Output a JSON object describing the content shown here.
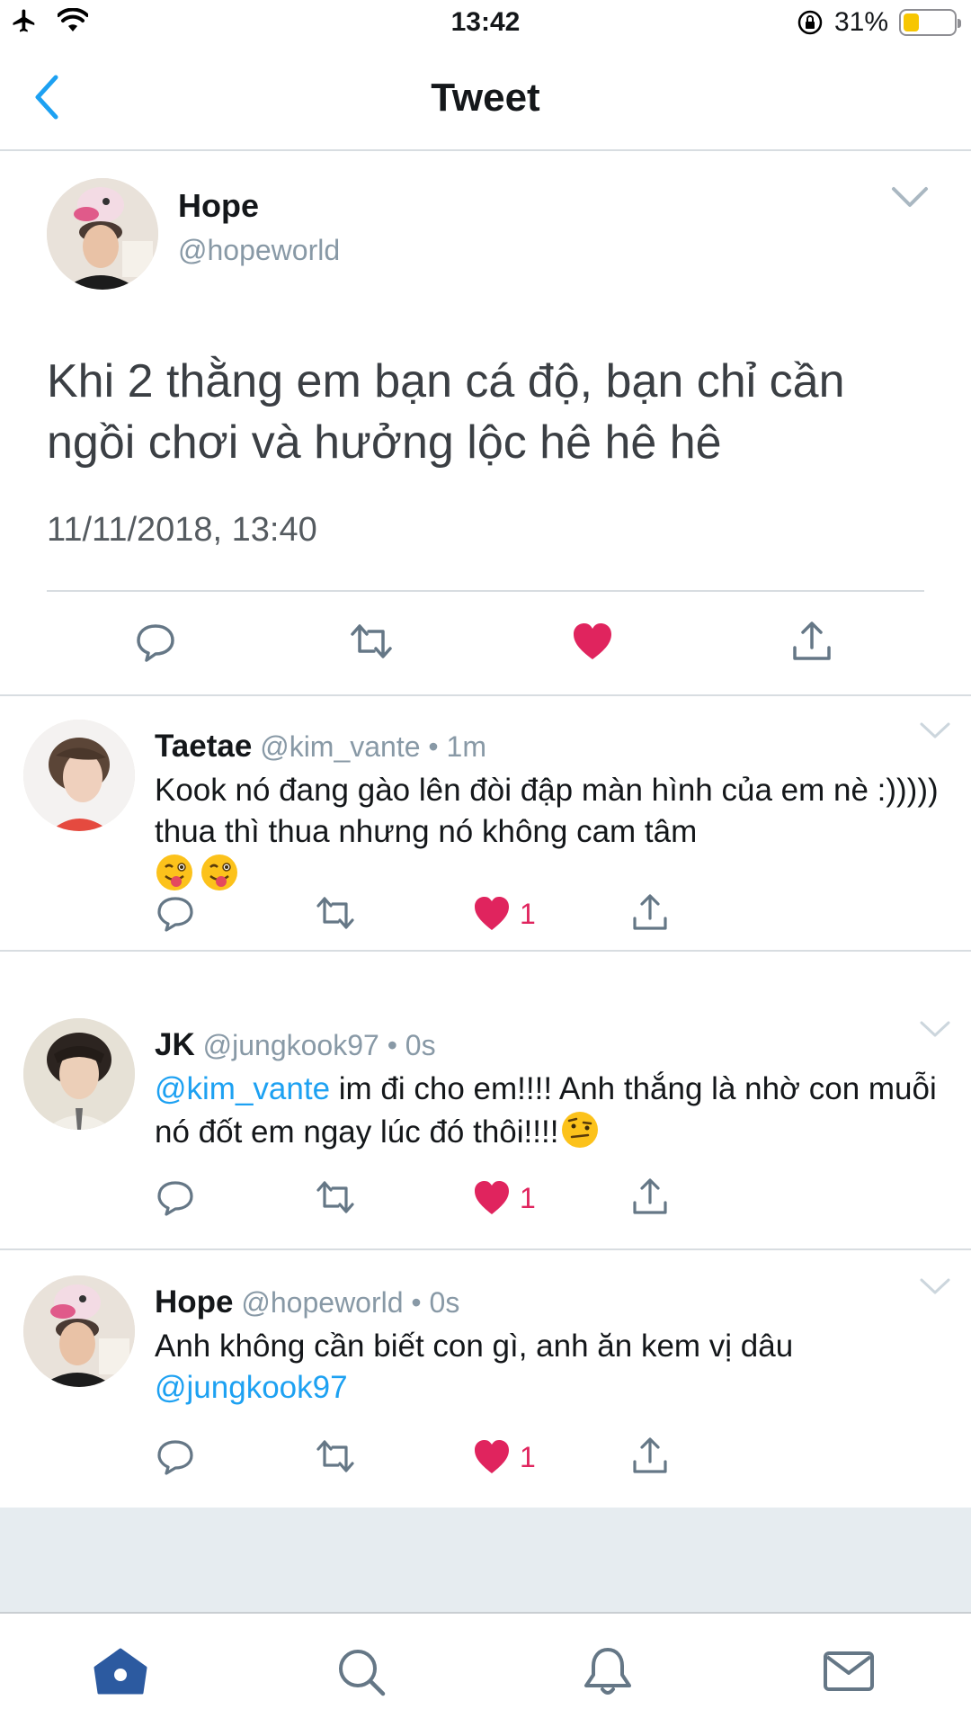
{
  "status_bar": {
    "time": "13:42",
    "battery_percent_label": "31%",
    "battery_level": 0.31,
    "icons": [
      "airplane-icon",
      "wifi-icon",
      "orientation-lock-icon",
      "battery-icon"
    ]
  },
  "nav": {
    "title": "Tweet",
    "back_icon": "chevron-left-icon"
  },
  "main_tweet": {
    "name": "Hope",
    "handle": "@hopeworld",
    "text": "Khi 2 thằng em bạn cá độ, bạn chỉ cần ngồi chơi và hưởng lộc hê hê hê",
    "date": "11/11/2018, 13:40",
    "liked": true,
    "actions": [
      "reply-icon",
      "retweet-icon",
      "like-icon",
      "share-icon"
    ]
  },
  "replies": [
    {
      "name": "Taetae",
      "handle": "@kim_vante",
      "time": "• 1m",
      "text": "Kook nó đang gào lên đòi đập màn hình của em nè :))))) thua thì thua nhưng nó không cam tâm",
      "emoji": [
        "winking-face-with-tongue",
        "winking-face-with-tongue"
      ],
      "likes": "1"
    },
    {
      "name": "JK",
      "handle": "@jungkook97",
      "time": "• 0s",
      "mention": "@kim_vante",
      "text": " im đi cho em!!!! Anh thắng là nhờ con muỗi nó đốt em ngay lúc đó thôi!!!!",
      "emoji": [
        "face-with-raised-eyebrow"
      ],
      "likes": "1"
    },
    {
      "name": "Hope",
      "handle": "@hopeworld",
      "time": "• 0s",
      "text": "Anh không cần biết con gì, anh ăn kem vị dâu ",
      "mention": "@jungkook97",
      "likes": "1"
    }
  ],
  "tab_bar": {
    "tabs": [
      "home-icon",
      "search-icon",
      "notifications-icon",
      "messages-icon"
    ],
    "active": "home-icon"
  },
  "colors": {
    "accent": "#1da1f2",
    "like": "#e0245e",
    "icon_gray": "#657786",
    "tab_active": "#2c5aa0"
  }
}
